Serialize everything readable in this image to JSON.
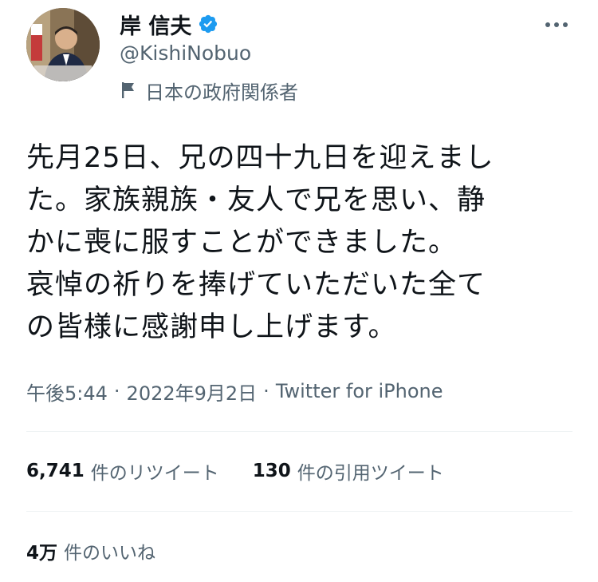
{
  "user": {
    "display_name": "岸 信夫",
    "handle": "@KishiNobuo",
    "affiliation": "日本の政府関係者",
    "verified_color": "#1d9bf0"
  },
  "tweet": {
    "lines": [
      "先月25日、兄の四十九日を迎えまし",
      "た。家族親族・友人で兄を思い、静",
      "かに喪に服すことができました。",
      "哀悼の祈りを捧げていただいた全て",
      "の皆様に感謝申し上げます。"
    ]
  },
  "meta": {
    "time": "午後5:44",
    "date": "2022年9月2日",
    "separator": "·",
    "client": "Twitter for iPhone"
  },
  "stats": {
    "retweets": {
      "count": "6,741",
      "label": "件のリツイート"
    },
    "quotes": {
      "count": "130",
      "label": "件の引用ツイート"
    },
    "likes": {
      "count": "4万",
      "label": "件のいいね"
    }
  },
  "icons": {
    "verified": "verified-badge-icon",
    "affiliation": "flag-icon",
    "more": "more-options-icon"
  }
}
